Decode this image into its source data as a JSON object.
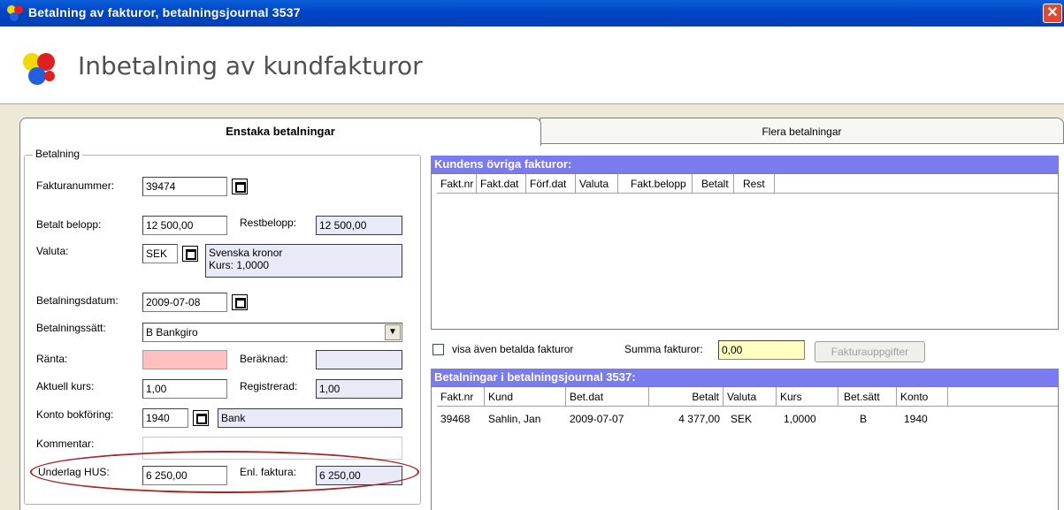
{
  "window": {
    "title": "Betalning av fakturor, betalningsjournal 3537",
    "close": "✕"
  },
  "header": {
    "title": "Inbetalning av kundfakturor"
  },
  "tabs": [
    {
      "label": "Enstaka betalningar"
    },
    {
      "label": "Flera betalningar"
    }
  ],
  "payment": {
    "group_label": "Betalning",
    "invoice_number_label": "Fakturanummer:",
    "invoice_number": "39474",
    "paid_amount_label": "Betalt belopp:",
    "paid_amount": "12 500,00",
    "remaining_label": "Restbelopp:",
    "remaining": "12 500,00",
    "currency_label": "Valuta:",
    "currency": "SEK",
    "currency_name": "Svenska kronor",
    "currency_rate": "Kurs: 1,0000",
    "payment_date_label": "Betalningsdatum:",
    "payment_date": "2009-07-08",
    "method_label": "Betalningssätt:",
    "method": "B  Bankgiro",
    "interest_label": "Ränta:",
    "interest": "",
    "calculated_label": "Beräknad:",
    "calculated": "",
    "current_rate_label": "Aktuell kurs:",
    "current_rate": "1,00",
    "registered_label": "Registrerad:",
    "registered": "1,00",
    "account_label": "Konto bokföring:",
    "account": "1940",
    "account_name": "Bank",
    "comment_label": "Kommentar:",
    "comment": "",
    "hus_label": "Underlag HUS:",
    "hus": "6 250,00",
    "per_invoice_label": "Enl. faktura:",
    "per_invoice": "6 250,00"
  },
  "other_invoices": {
    "title": "Kundens övriga fakturor:",
    "columns": [
      "Fakt.nr",
      "Fakt.dat",
      "Förf.dat",
      "Valuta",
      "Fakt.belopp",
      "Betalt",
      "Rest"
    ],
    "show_paid_label": "visa även betalda fakturor",
    "sum_label": "Summa fakturor:",
    "sum": "0,00",
    "details_button": "Fakturauppgifter"
  },
  "journal": {
    "title": "Betalningar i betalningsjournal 3537:",
    "columns": [
      "Fakt.nr",
      "Kund",
      "Bet.dat",
      "Betalt",
      "Valuta",
      "Kurs",
      "Bet.sätt",
      "Konto"
    ],
    "rows": [
      {
        "fakt_nr": "39468",
        "kund": "Sahlin, Jan",
        "bet_dat": "2009-07-07",
        "betalt": "4 377,00",
        "valuta": "SEK",
        "kurs": "1,0000",
        "bet_satt": "B",
        "konto": "1940"
      }
    ]
  }
}
